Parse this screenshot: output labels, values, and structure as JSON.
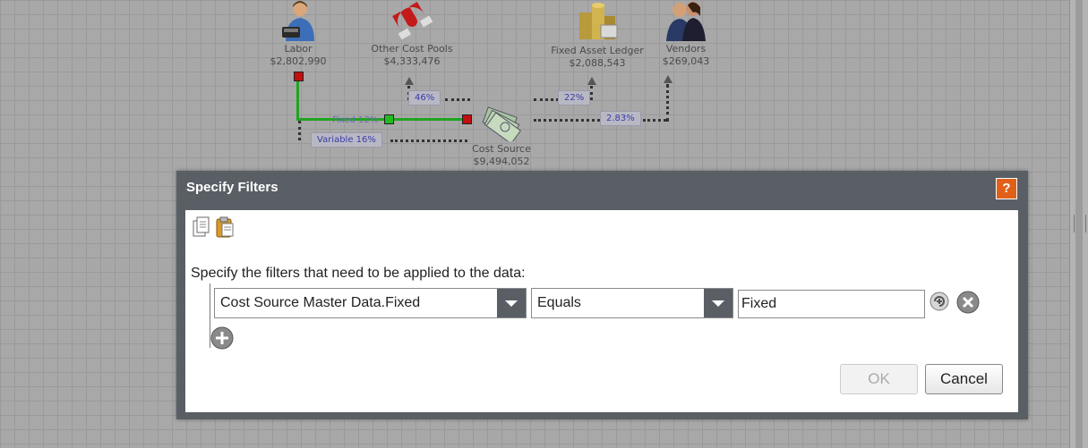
{
  "diagram": {
    "nodes": [
      {
        "id": "labor",
        "label": "Labor",
        "value": "$2,802,990",
        "icon": "worker-icon"
      },
      {
        "id": "other-cost-pools",
        "label": "Other Cost Pools",
        "value": "$4,333,476",
        "icon": "magnet-icon"
      },
      {
        "id": "fixed-asset-ledger",
        "label": "Fixed Asset Ledger",
        "value": "$2,088,543",
        "icon": "coins-icon"
      },
      {
        "id": "vendors",
        "label": "Vendors",
        "value": "$269,043",
        "icon": "people-icon"
      },
      {
        "id": "cost-source",
        "label": "Cost Source",
        "value": "$9,494,052",
        "icon": "money-icon"
      }
    ],
    "edge_labels": {
      "other_pools": "46%",
      "fixed_asset": "22%",
      "vendors": "2.83%",
      "fixed": "Fixed 12%",
      "variable": "Variable 16%"
    }
  },
  "dialog": {
    "title": "Specify Filters",
    "help_label": "?",
    "toolbar": {
      "copy_icon": "copy-icon",
      "paste_icon": "paste-icon"
    },
    "instruction": "Specify the filters that need to be applied to the data:",
    "filter": {
      "field": "Cost Source Master Data.Fixed",
      "operator": "Equals",
      "value": "Fixed"
    },
    "ok_label": "OK",
    "cancel_label": "Cancel"
  },
  "colors": {
    "dialog_frame": "#5a5f66",
    "help_orange": "#e0601a",
    "connection_green": "#1fa51f",
    "handle_red": "#c01010",
    "label_blue": "#3a3aa8"
  }
}
